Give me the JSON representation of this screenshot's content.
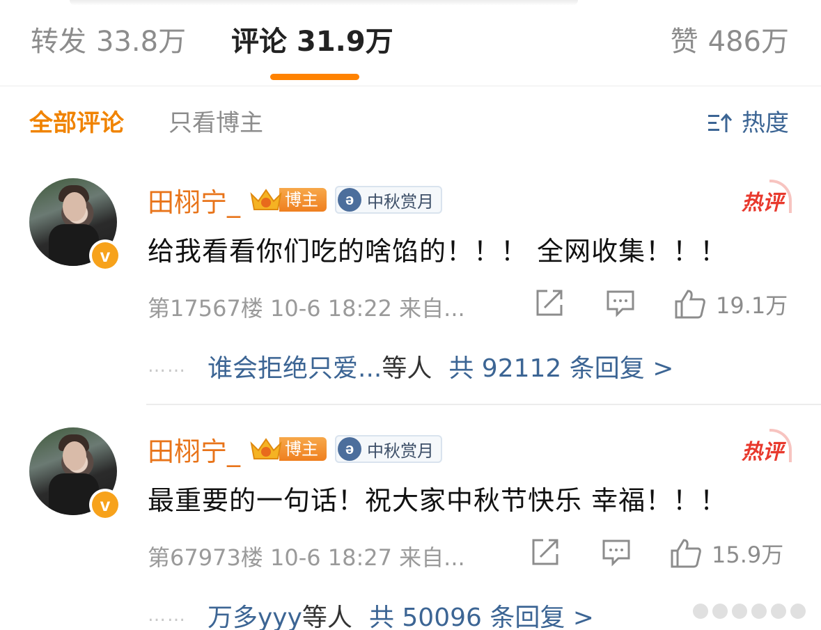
{
  "tabs": {
    "repost": {
      "label": "转发",
      "count": "33.8万"
    },
    "comment": {
      "label": "评论",
      "count": "31.9万"
    },
    "like": {
      "label": "赞",
      "count": "486万"
    }
  },
  "filters": {
    "all": "全部评论",
    "host_only": "只看博主",
    "sort": "热度",
    "sort_icon": "sort-icon"
  },
  "colors": {
    "accent": "#ff8200",
    "username": "#e8741a",
    "link": "#3c6594",
    "hot": "#e8392d"
  },
  "comments": [
    {
      "username": "田栩宁_",
      "badge_blogger": "博主",
      "badge_event": "中秋赏月",
      "hot_label": "热评",
      "text": "给我看看你们吃的啥馅的！！！ 全网收集！！！",
      "floor_time_source": "第17567楼  10-6 18:22  来自...",
      "likes": "19.1万",
      "reply_dots": "……",
      "reply_who": "谁会拒绝只爱...",
      "reply_etc": "等人",
      "reply_count": "共 92112 条回复 >"
    },
    {
      "username": "田栩宁_",
      "badge_blogger": "博主",
      "badge_event": "中秋赏月",
      "hot_label": "热评",
      "text": "最重要的一句话！祝大家中秋节快乐 幸福！！！",
      "floor_time_source": "第67973楼  10-6 18:27  来自...",
      "likes": "15.9万",
      "reply_dots": "……",
      "reply_who": "万多yyy",
      "reply_etc": "等人",
      "reply_count": "共 50096 条回复 >"
    }
  ]
}
